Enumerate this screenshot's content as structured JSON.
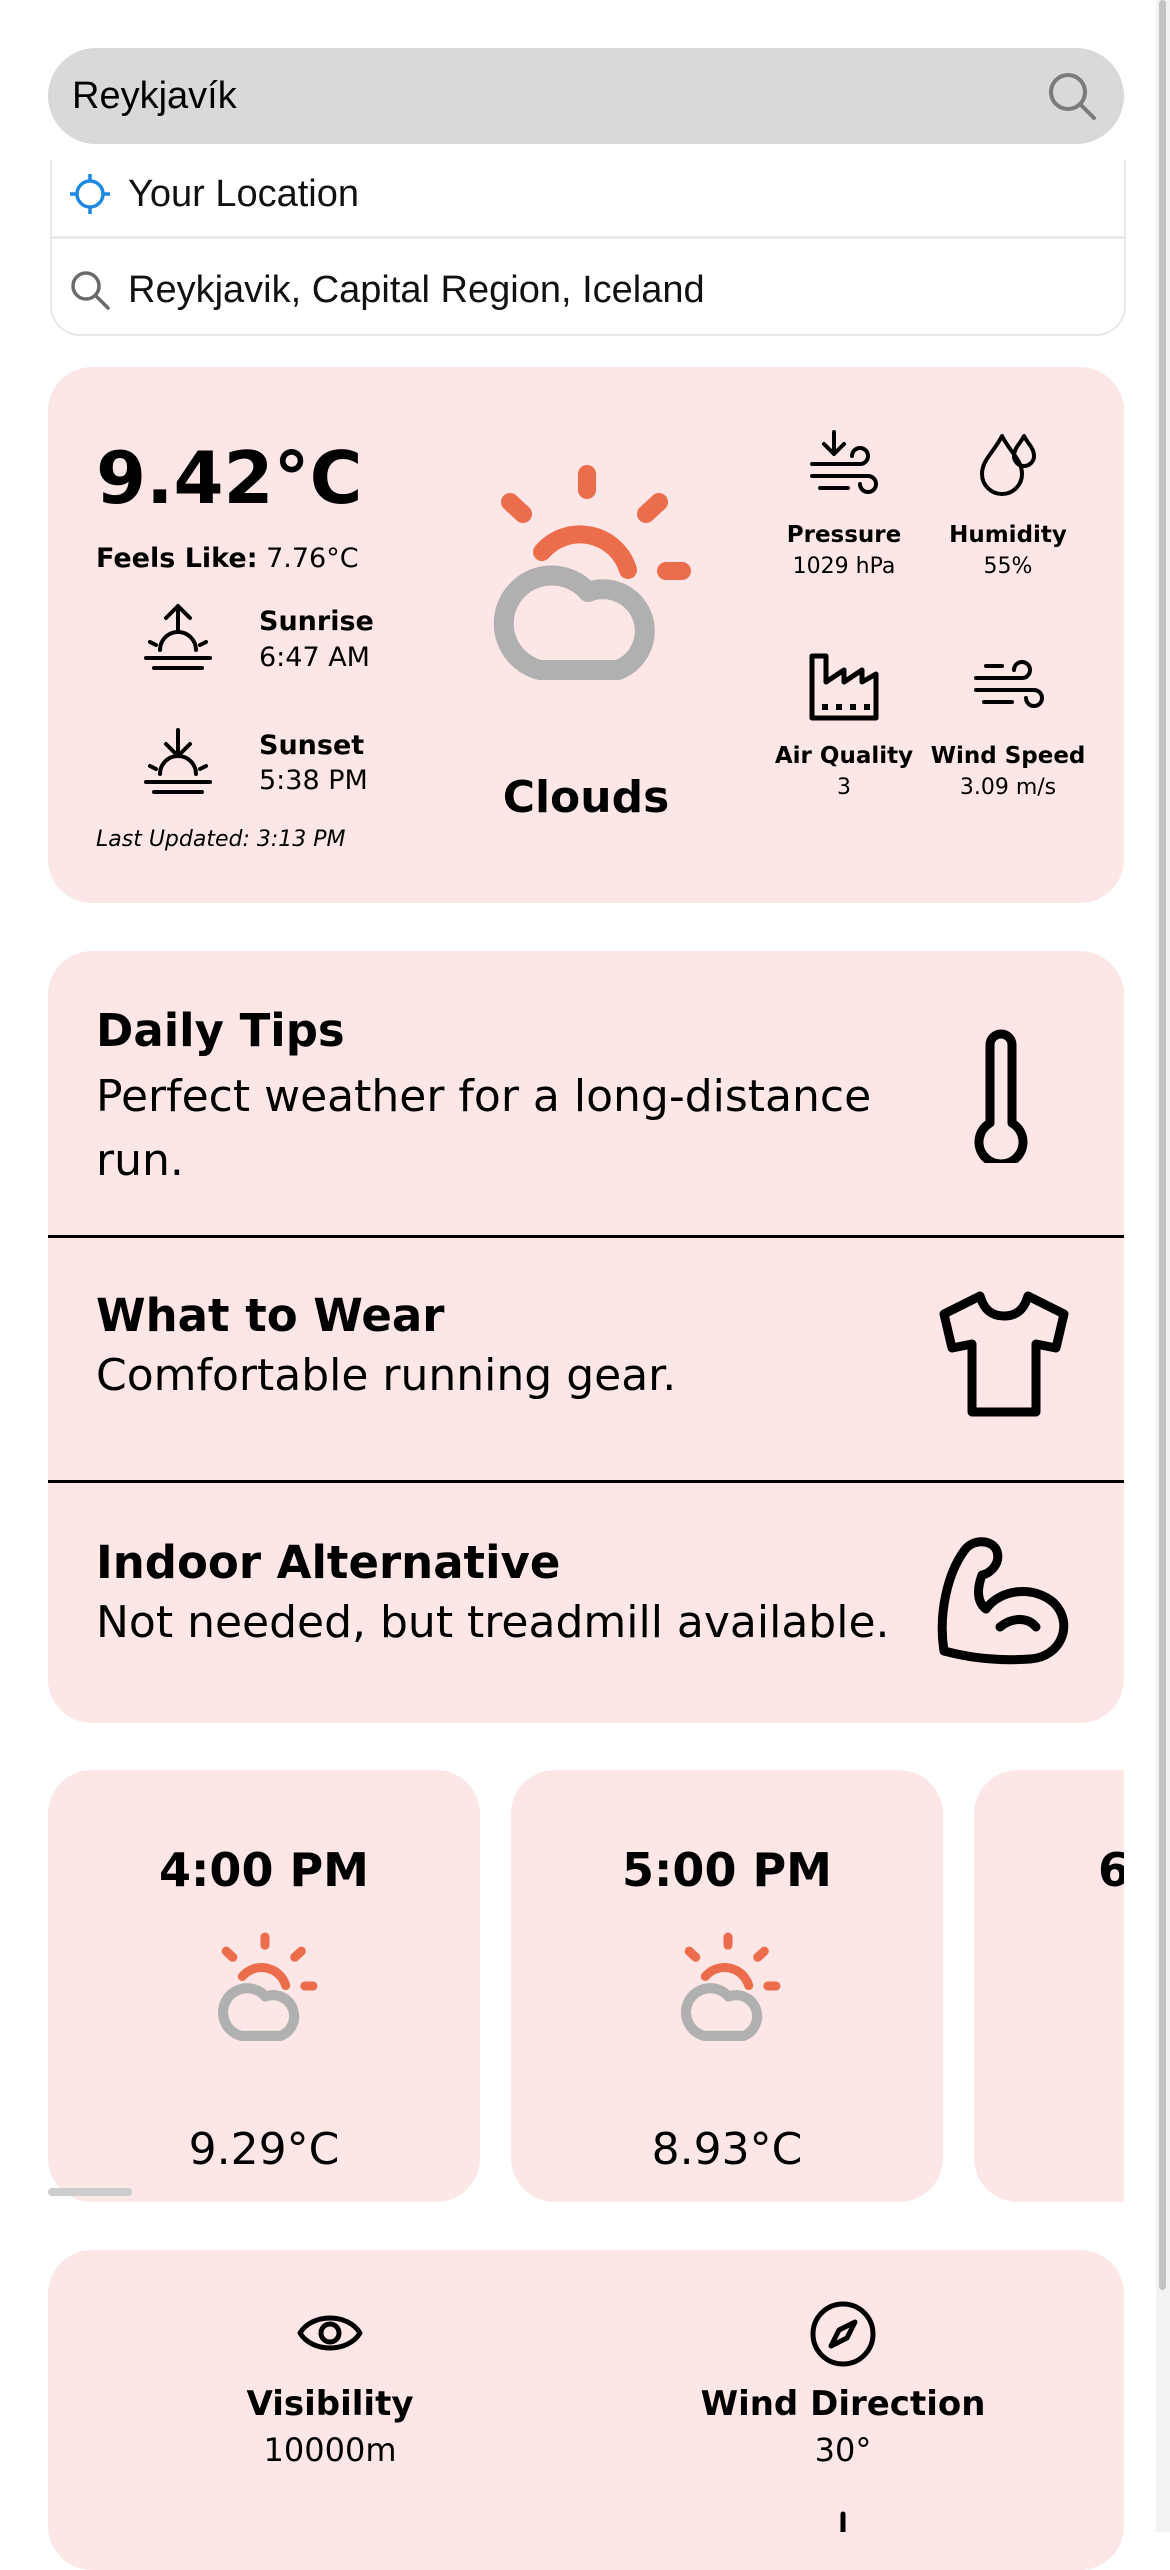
{
  "search": {
    "value": "Reykjavík",
    "icon": "search-icon"
  },
  "suggestions": [
    {
      "label": "Your Location",
      "icon": "location-crosshair-icon",
      "icon_color": "#1e88e5"
    },
    {
      "label": "Reykjavik, Capital Region, Iceland",
      "icon": "search-icon"
    }
  ],
  "current": {
    "temperature": "9.42°C",
    "feels_like_label": "Feels Like:",
    "feels_like_value": "7.76°C",
    "sunrise_label": "Sunrise",
    "sunrise_time": "6:47 AM",
    "sunset_label": "Sunset",
    "sunset_time": "5:38 PM",
    "last_updated": "Last Updated: 3:13 PM",
    "condition": "Clouds",
    "stats": [
      {
        "label": "Pressure",
        "value": "1029 hPa",
        "icon": "pressure-icon"
      },
      {
        "label": "Humidity",
        "value": "55%",
        "icon": "humidity-icon"
      },
      {
        "label": "Air Quality",
        "value": "3",
        "icon": "factory-icon"
      },
      {
        "label": "Wind Speed",
        "value": "3.09 m/s",
        "icon": "wind-icon"
      }
    ]
  },
  "tips": [
    {
      "title": "Daily Tips",
      "text": "Perfect weather for a long-distance run.",
      "icon": "thermometer-icon"
    },
    {
      "title": "What to Wear",
      "text": "Comfortable running gear.",
      "icon": "tshirt-icon"
    },
    {
      "title": "Indoor Alternative",
      "text": "Not needed, but treadmill available.",
      "icon": "muscle-icon"
    }
  ],
  "hourly": [
    {
      "time": "4:00 PM",
      "temp": "9.29°C",
      "icon": "sun-cloud-icon"
    },
    {
      "time": "5:00 PM",
      "temp": "8.93°C",
      "icon": "sun-cloud-icon"
    },
    {
      "time": "6",
      "icon": "sun-cloud-icon"
    }
  ],
  "details": [
    {
      "label": "Visibility",
      "value": "10000m",
      "icon": "eye-icon"
    },
    {
      "label": "Wind Direction",
      "value": "30°",
      "icon": "compass-icon"
    }
  ],
  "colors": {
    "card_bg": "#fce6e6",
    "sun_orange": "#ec6d4c",
    "cloud_gray": "#b0b0b0",
    "search_bg": "#d9d9d9"
  }
}
